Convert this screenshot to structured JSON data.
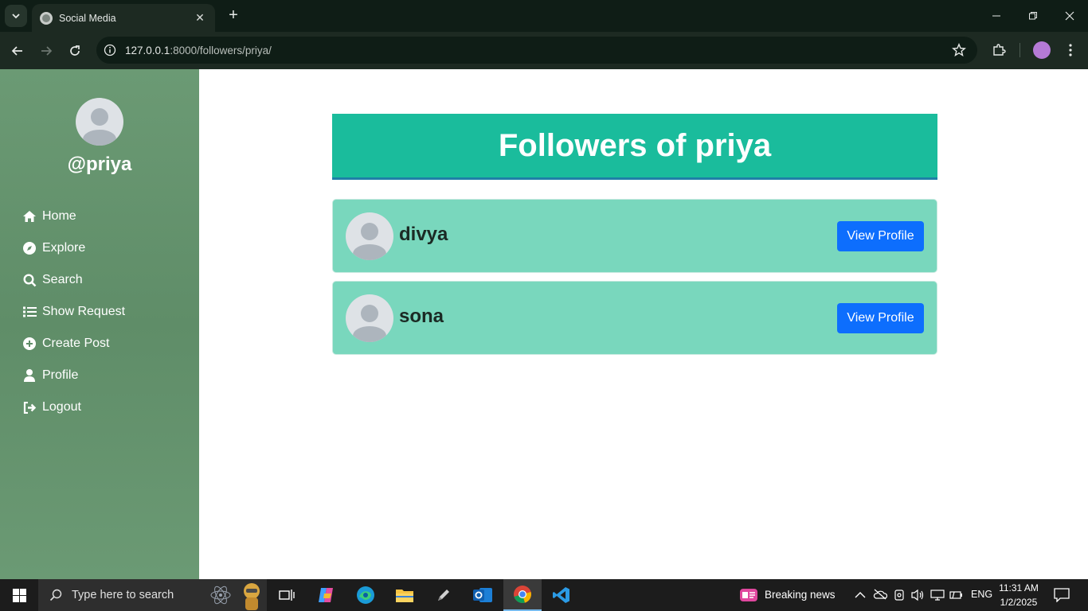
{
  "browser": {
    "tab_title": "Social Media",
    "url_host": "127.0.0.1",
    "url_path": ":8000/followers/priya/"
  },
  "sidebar": {
    "username": "@priya",
    "items": [
      {
        "label": "Home",
        "icon": "home-icon"
      },
      {
        "label": "Explore",
        "icon": "compass-icon"
      },
      {
        "label": "Search",
        "icon": "search-icon"
      },
      {
        "label": "Show Request",
        "icon": "list-icon"
      },
      {
        "label": "Create Post",
        "icon": "plus-circle-icon"
      },
      {
        "label": "Profile",
        "icon": "user-icon"
      },
      {
        "label": "Logout",
        "icon": "logout-icon"
      }
    ]
  },
  "main": {
    "title": "Followers of priya",
    "followers": [
      {
        "name": "divya",
        "button": "View Profile"
      },
      {
        "name": "sona",
        "button": "View Profile"
      }
    ]
  },
  "taskbar": {
    "search_placeholder": "Type here to search",
    "news": "Breaking news",
    "language": "ENG",
    "time": "11:31 AM",
    "date": "1/2/2025"
  },
  "colors": {
    "sidebar": "#6b9a74",
    "header": "#1abc9c",
    "card": "#79d7bd",
    "button": "#0d6efd"
  }
}
